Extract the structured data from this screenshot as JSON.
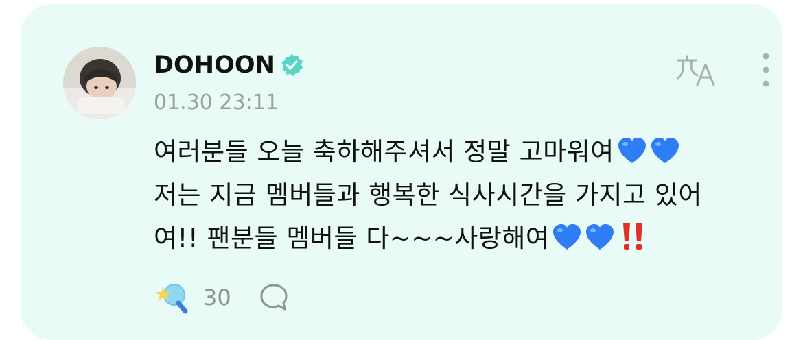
{
  "post": {
    "author": "DOHOON",
    "timestamp": "01.30 23:11",
    "lines": [
      "여러분들 오늘 축하해주셔서 정말 고마워여",
      "저는 지금 멤버들과 행복한 식사시간을 가지고 있어",
      "여!! 팬분들 멤버들 다~~~사랑해여"
    ],
    "like_count": "30"
  },
  "icons": {
    "verified": "verified-check-icon",
    "translate": "translate-icon",
    "more": "more-vertical-icon",
    "light": "lightstick-star-icon",
    "comment": "comment-bubble-icon",
    "heart": "blue-heart-emoji",
    "exclamation": "double-exclamation-emoji"
  },
  "colors": {
    "card_background": "#e8fbf6",
    "verified": "#5ad4c4",
    "accent_blue": "#2f7df6",
    "exclamation_red": "#e0302a",
    "muted_text": "#9aa09e"
  }
}
